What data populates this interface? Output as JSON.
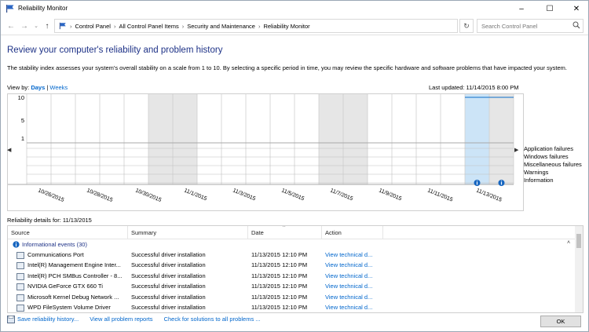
{
  "window": {
    "title": "Reliability Monitor",
    "minimize": "–",
    "maximize": "☐",
    "close": "✕"
  },
  "address": {
    "crumbs": [
      "Control Panel",
      "All Control Panel Items",
      "Security and Maintenance",
      "Reliability Monitor"
    ],
    "search_placeholder": "Search Control Panel"
  },
  "heading": "Review your computer's reliability and problem history",
  "description": "The stability index assesses your system's overall stability on a scale from 1 to 10. By selecting a specific period in time, you may review the specific hardware and software problems that have impacted your system.",
  "view_by": {
    "label": "View by:",
    "days": "Days",
    "separator": "|",
    "weeks": "Weeks"
  },
  "last_updated": "Last updated: 11/14/2015 8:00 PM",
  "chart_data": {
    "type": "line",
    "y_ticks": [
      "10",
      "5",
      "1"
    ],
    "ylim": [
      1,
      10
    ],
    "x_labels": [
      "10/26/2015",
      "10/28/2015",
      "10/30/2015",
      "11/1/2015",
      "11/3/2015",
      "11/5/2015",
      "11/7/2015",
      "11/9/2015",
      "11/11/2015",
      "11/13/2015"
    ],
    "days": [
      "10/26/2015",
      "10/27/2015",
      "10/28/2015",
      "10/29/2015",
      "10/30/2015",
      "10/31/2015",
      "11/1/2015",
      "11/2/2015",
      "11/3/2015",
      "11/4/2015",
      "11/5/2015",
      "11/6/2015",
      "11/7/2015",
      "11/8/2015",
      "11/9/2015",
      "11/10/2015",
      "11/11/2015",
      "11/12/2015",
      "11/13/2015",
      "11/14/2015"
    ],
    "stability_index": [
      null,
      null,
      null,
      null,
      null,
      null,
      null,
      null,
      null,
      null,
      null,
      null,
      null,
      null,
      null,
      null,
      null,
      null,
      10,
      10
    ],
    "weekend_days": [
      "10/31/2015",
      "11/1/2015",
      "11/7/2015",
      "11/8/2015",
      "10/25/2015",
      "11/14/2015"
    ],
    "selected_day": "11/13/2015",
    "information_events_days": [
      "11/13/2015",
      "11/14/2015"
    ],
    "rows": [
      "Application failures",
      "Windows failures",
      "Miscellaneous failures",
      "Warnings",
      "Information"
    ]
  },
  "details": {
    "label": "Reliability details for: 11/13/2015",
    "columns": [
      "Source",
      "Summary",
      "Date",
      "Action"
    ],
    "group": "Informational events (30)",
    "rows": [
      {
        "source": "Communications Port",
        "summary": "Successful driver installation",
        "date": "11/13/2015 12:10 PM",
        "action": "View  technical d..."
      },
      {
        "source": "Intel(R) Management Engine Inter...",
        "summary": "Successful driver installation",
        "date": "11/13/2015 12:10 PM",
        "action": "View  technical d..."
      },
      {
        "source": "Intel(R) PCH SMBus Controller - 8...",
        "summary": "Successful driver installation",
        "date": "11/13/2015 12:10 PM",
        "action": "View  technical d..."
      },
      {
        "source": "NVIDIA GeForce GTX 660 Ti",
        "summary": "Successful driver installation",
        "date": "11/13/2015 12:10 PM",
        "action": "View  technical d..."
      },
      {
        "source": "Microsoft Kernel Debug Network ...",
        "summary": "Successful driver installation",
        "date": "11/13/2015 12:10 PM",
        "action": "View  technical d..."
      },
      {
        "source": "WPD FileSystem Volume Driver",
        "summary": "Successful driver installation",
        "date": "11/13/2015 12:10 PM",
        "action": "View  technical d..."
      }
    ]
  },
  "bottom": {
    "save": "Save reliability history...",
    "view_all": "View all problem reports",
    "check": "Check for solutions to all problems ...",
    "ok": "OK"
  },
  "colors": {
    "accent": "#1e3287",
    "link": "#0066cc",
    "selected": "#cce4f7",
    "info_icon": "#1565c0",
    "line": "#0a6cc8"
  }
}
